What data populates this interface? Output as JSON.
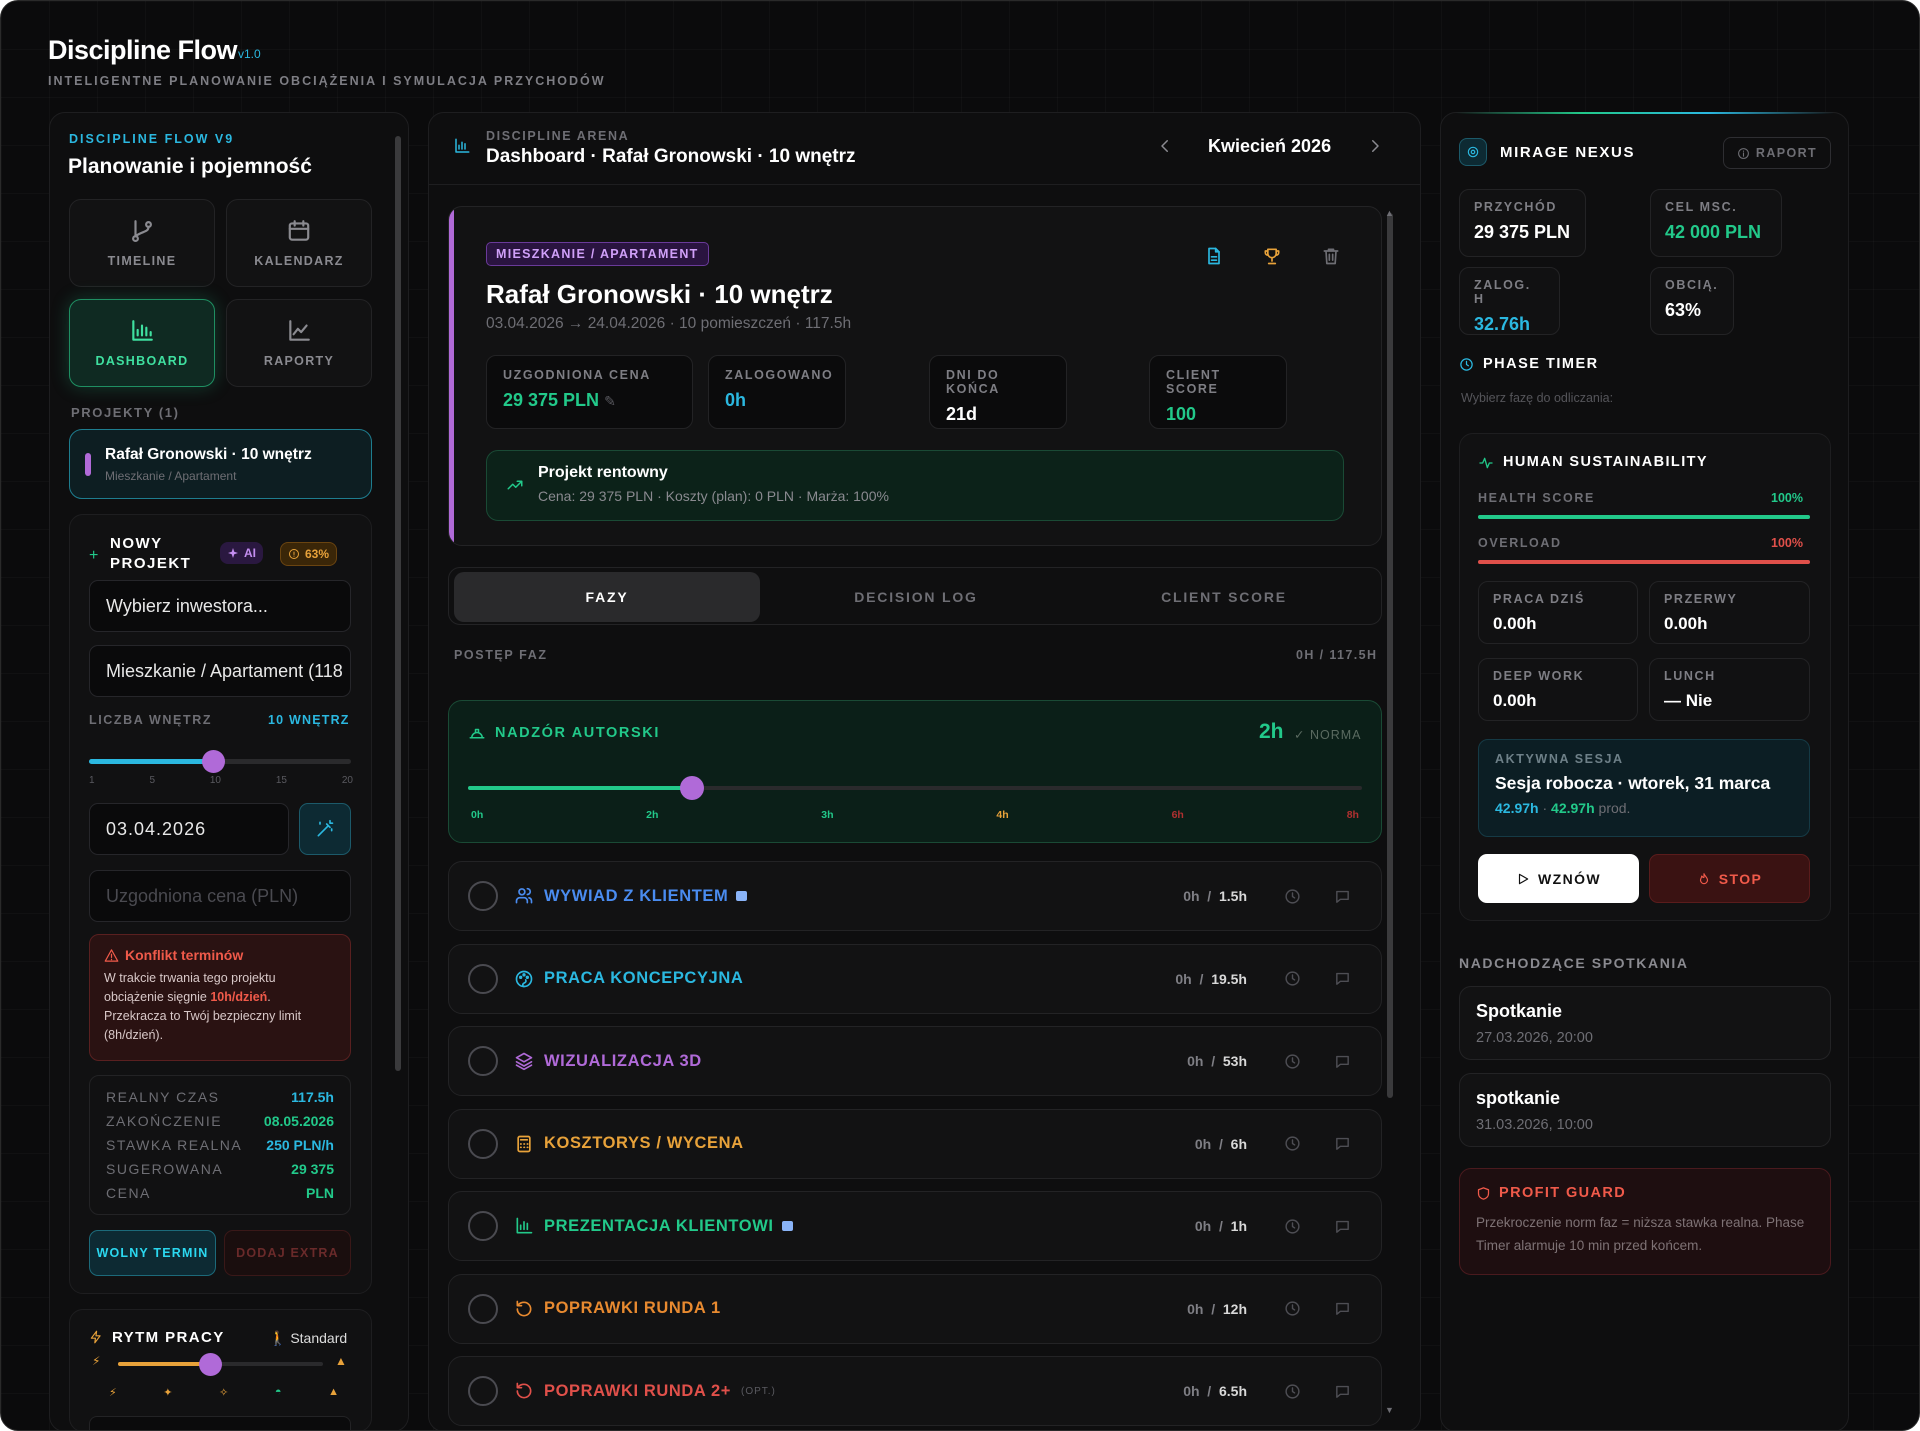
{
  "app": {
    "title": "Discipline Flow",
    "version": "v1.0",
    "subtitle": "INTELIGENTNE PLANOWANIE OBCIĄŻENIA I SYMULACJA PRZYCHODÓW"
  },
  "left": {
    "kicker": "DISCIPLINE FLOW V9",
    "heading": "Planowanie i pojemność",
    "nav": {
      "timeline": "TIMELINE",
      "calendar": "KALENDARZ",
      "dashboard": "DASHBOARD",
      "reports": "RAPORTY"
    },
    "projects_label": "PROJEKTY (1)",
    "project": {
      "name": "Rafał Gronowski · 10 wnętrz",
      "type": "Mieszkanie / Apartament"
    },
    "new_project": {
      "title_line1": "NOWY",
      "title_line2": "PROJEKT",
      "ai_badge": "AI",
      "load_badge": "63%",
      "investor_value": "Wybierz inwestora...",
      "type_value": "Mieszkanie / Apartament (118",
      "rooms_label": "LICZBA WNĘTRZ",
      "rooms_value": "10 WNĘTRZ",
      "rooms_count": 10,
      "ticks": [
        "1",
        "5",
        "10",
        "15",
        "20"
      ],
      "date": "03.04.2026",
      "price_placeholder": "Uzgodniona cena (PLN)"
    },
    "conflict": {
      "title": "Konflikt terminów",
      "text_a": "W trakcie trwania tego projektu obciążenie sięgnie ",
      "text_b": "10h/dzień",
      "text_c": ". Przekracza to Twój bezpieczny limit (8h/dzień)."
    },
    "stats": [
      {
        "label": "REALNY CZAS",
        "value": "117.5h",
        "color": "#2bb8e0"
      },
      {
        "label": "ZAKOŃCZENIE",
        "value": "08.05.2026",
        "color": "#22c98a"
      },
      {
        "label": "STAWKA REALNA",
        "value": "250 PLN/h",
        "color": "#2bb8e0"
      },
      {
        "label": "SUGEROWANA",
        "value": "29 375",
        "color": "#22c98a"
      },
      {
        "label": "CENA",
        "value": "PLN",
        "color": "#22c98a"
      }
    ],
    "free_btn": "WOLNY TERMIN",
    "extra_btn": "DODAJ EXTRA",
    "rhythm": {
      "title": "RYTM PRACY",
      "mode": "Standard",
      "level": 0.45
    }
  },
  "center": {
    "kicker": "DISCIPLINE ARENA",
    "title": "Dashboard · Rafał Gronowski · 10 wnętrz",
    "month": "Kwiecień 2026",
    "project": {
      "badge": "MIESZKANIE / APARTAMENT",
      "title": "Rafał Gronowski · 10 wnętrz",
      "meta": "03.04.2026 → 24.04.2026 · 10 pomieszczeń · 117.5h",
      "metrics": [
        {
          "label": "UZGODNIONA CENA",
          "value": "29 375 PLN",
          "color": "#22c98a"
        },
        {
          "label": "ZALOGOWANO",
          "value": "0h",
          "color": "#2bb8e0"
        },
        {
          "label": "DNI DO KOŃCA",
          "value": "21d",
          "color": "#ffffff"
        },
        {
          "label": "CLIENT SCORE",
          "value": "100",
          "color": "#22c98a"
        }
      ],
      "profit_title": "Projekt rentowny",
      "profit_text": "Cena: 29 375 PLN · Koszty (plan): 0 PLN · Marża: 100%"
    },
    "tabs": [
      "FAZY",
      "DECISION LOG",
      "CLIENT SCORE"
    ],
    "progress_label": "POSTĘP FAZ",
    "progress_value": "0H / 117.5H",
    "supervision": {
      "title": "NADZÓR AUTORSKI",
      "hours": "2h",
      "norm": "✓ NORMA",
      "level": 0.25,
      "ticks": [
        {
          "t": "0h",
          "c": "#22c98a"
        },
        {
          "t": "2h",
          "c": "#22c98a"
        },
        {
          "t": "3h",
          "c": "#22c98a"
        },
        {
          "t": "4h",
          "c": "#e8a23a"
        },
        {
          "t": "6h",
          "c": "#b03030"
        },
        {
          "t": "8h",
          "c": "#b03030"
        }
      ]
    },
    "phases": [
      {
        "name": "WYWIAD Z KLIENTEM",
        "logged": "0h",
        "plan": "1.5h",
        "color": "#4a8cf0",
        "icon": "users-icon"
      },
      {
        "name": "PRACA KONCEPCYJNA",
        "logged": "0h",
        "plan": "19.5h",
        "color": "#2bb8e0",
        "icon": "palette-icon"
      },
      {
        "name": "WIZUALIZACJA 3D",
        "logged": "0h",
        "plan": "53h",
        "color": "#b06ad8",
        "icon": "layers-icon"
      },
      {
        "name": "KOSZTORYS / WYCENA",
        "logged": "0h",
        "plan": "6h",
        "color": "#e8a23a",
        "icon": "calculator-icon"
      },
      {
        "name": "PREZENTACJA KLIENTOWI",
        "logged": "0h",
        "plan": "1h",
        "color": "#22c98a",
        "icon": "chart-icon"
      },
      {
        "name": "POPRAWKI RUNDA 1",
        "logged": "0h",
        "plan": "12h",
        "color": "#e88a30",
        "icon": "refresh-icon"
      },
      {
        "name": "POPRAWKI RUNDA 2+",
        "logged": "0h",
        "plan": "6.5h",
        "color": "#e0504a",
        "icon": "refresh-icon",
        "opt": "(OPT.)"
      }
    ]
  },
  "right": {
    "title": "MIRAGE NEXUS",
    "report_btn": "RAPORT",
    "metrics": [
      {
        "label": "PRZYCHÓD",
        "value": "29 375 PLN",
        "color": "#ffffff"
      },
      {
        "label": "CEL MSC.",
        "value": "42 000 PLN",
        "color": "#22c98a"
      },
      {
        "label": "ZALOG. H",
        "value": "32.76h",
        "color": "#2bb8e0"
      },
      {
        "label": "OBCIĄ.",
        "value": "63%",
        "color": "#ffffff"
      }
    ],
    "phase_timer": {
      "title": "PHASE TIMER",
      "hint": "Wybierz fazę do odliczania:"
    },
    "sustain": {
      "title": "HUMAN SUSTAINABILITY",
      "health_label": "HEALTH SCORE",
      "health_value": "100%",
      "health_level": 1.0,
      "overload_label": "OVERLOAD",
      "overload_value": "100%",
      "overload_level": 1.0,
      "cells": [
        {
          "label": "PRACA DZIŚ",
          "value": "0.00h"
        },
        {
          "label": "PRZERWY",
          "value": "0.00h"
        },
        {
          "label": "DEEP WORK",
          "value": "0.00h"
        },
        {
          "label": "LUNCH",
          "value": "— Nie"
        }
      ],
      "session_label": "AKTYWNA SESJA",
      "session_title": "Sesja robocza · wtorek, 31 marca",
      "session_a": "42.97h",
      "session_b": "42.97h",
      "session_c": "prod.",
      "resume": "WZNÓW",
      "stop": "STOP"
    },
    "meetings_label": "NADCHODZĄCE SPOTKANIA",
    "meetings": [
      {
        "title": "Spotkanie",
        "date": "27.03.2026, 20:00"
      },
      {
        "title": "spotkanie",
        "date": "31.03.2026, 10:00"
      }
    ],
    "guard": {
      "title": "PROFIT GUARD",
      "text": "Przekroczenie norm faz = niższa stawka realna. Phase Timer alarmuje 10 min przed końcem."
    }
  }
}
